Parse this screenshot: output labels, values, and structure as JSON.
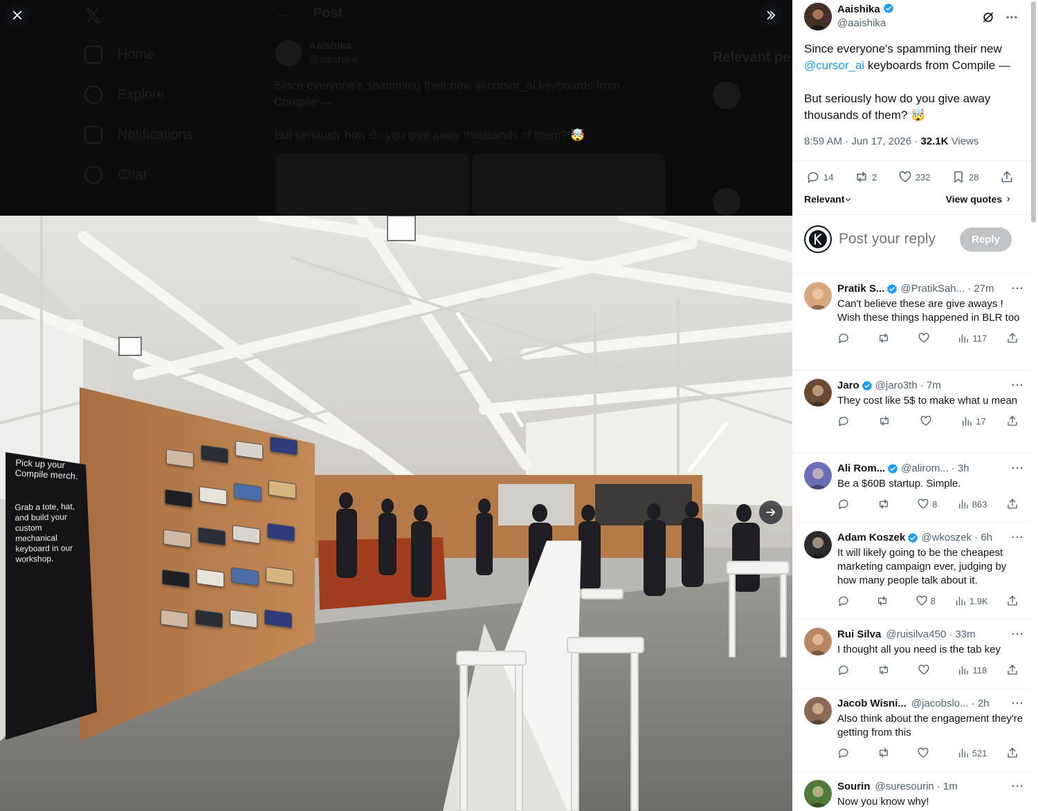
{
  "background": {
    "nav": [
      "Home",
      "Explore",
      "Notifications",
      "Chat"
    ],
    "header_title": "Post",
    "author_name": "Aaishika",
    "author_handle": "@aaishika",
    "text_line1": "Since everyone's spamming their new @cursor_ai keyboards from",
    "text_line2": "Compile —",
    "text_line3": "But seriously how do you give away thousands of them? 🤯",
    "sidebar_title": "Relevant pe"
  },
  "media": {
    "sign_title": "Pick up your Compile merch.",
    "sign_body": "Grab a tote, hat, and build your custom mechanical keyboard in our workshop."
  },
  "post": {
    "author_name": "Aaishika",
    "author_handle": "@aaishika",
    "text_before_link": "Since everyone's spamming their new",
    "link": "@cursor_ai",
    "text_after_link": "keyboards from Compile —",
    "text_second": "But seriously how do you give away thousands of them? 🤯",
    "time": "8:59 AM · Jun 17, 2026 · ",
    "views_count": "32.1K",
    "views_label": " Views",
    "stats": {
      "replies": "14",
      "reposts": "2",
      "likes": "232",
      "bookmarks": "28"
    },
    "sort_label": "Relevant",
    "view_quotes": "View quotes"
  },
  "reply_box": {
    "placeholder": "Post your reply",
    "button": "Reply"
  },
  "replies": [
    {
      "name": "Pratik S...",
      "handle": "@PratikSah...",
      "time": "· 27m",
      "text": "Can't believe these are give aways ! Wish these things happened in BLR too",
      "likes": "",
      "views": "117",
      "avatar_color": "#d9a77e"
    },
    {
      "name": "Jaro",
      "handle": "@jaro3th",
      "time": "· 7m",
      "text": "They cost like 5$ to make what u mean",
      "likes": "",
      "views": "17",
      "avatar_color": "#6b4a33"
    },
    {
      "name": "Ali Rom...",
      "handle": "@alirom...",
      "time": "· 3h",
      "text": "Be a $60B startup. Simple.",
      "likes": "8",
      "views": "863",
      "avatar_color": "#6a6fb5"
    },
    {
      "name": "Adam Koszek",
      "handle": "@wkoszek",
      "time": "· 6h",
      "text": "It will likely going to be the cheapest marketing campaign ever, judging by how many people talk about it.",
      "likes": "8",
      "views": "1.9K",
      "avatar_color": "#2b2b2b"
    },
    {
      "name": "Rui Silva",
      "handle": "@ruisilva450",
      "time": "· 33m",
      "text": "I thought all you need is the tab key",
      "likes": "",
      "views": "118",
      "avatar_color": "#b98664"
    },
    {
      "name": "Jacob Wisni...",
      "handle": "@jacobslo...",
      "time": "· 2h",
      "text": "Also think about the engagement they're getting from this",
      "likes": "",
      "views": "521",
      "avatar_color": "#8a6a55"
    },
    {
      "name": "Sourin",
      "handle": "@suresourin",
      "time": "· 1m",
      "text": "Now you know why!",
      "likes": "",
      "views": "",
      "avatar_color": "#4f7a3c"
    }
  ]
}
